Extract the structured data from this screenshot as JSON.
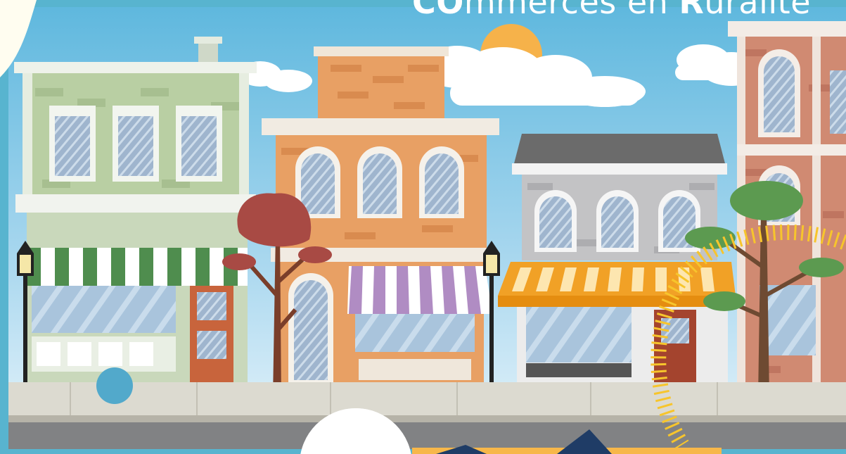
{
  "headline": {
    "part1_bold": "CO",
    "part2": "mmerces en ",
    "part3_bold": "R",
    "part4": "uralité"
  },
  "colors": {
    "frame": "#58b4cf",
    "sky": "#bfe1f2",
    "green_shop": "#b9cfa3",
    "orange_shop": "#e8a064",
    "grey_shop": "#c3c3c5",
    "brick_shop": "#d08a72",
    "awning_yellow": "#f1a126",
    "navy": "#1f3c66",
    "dash_yellow": "#f7c52c"
  }
}
